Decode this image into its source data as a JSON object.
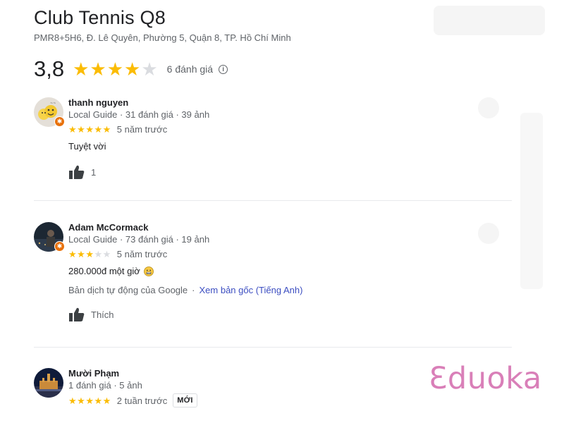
{
  "place": {
    "title": "Club Tennis Q8",
    "address": "PMR8+5H6, Đ. Lê Quyên, Phường 5, Quận 8, TP. Hồ Chí Minh",
    "rating": "3,8",
    "rating_value": 3.8,
    "review_count": "6 đánh giá",
    "info_icon": "info-icon"
  },
  "reviews": [
    {
      "name": "thanh nguyen",
      "meta": "Local Guide · 31 đánh giá · 39 ảnh",
      "stars": 5,
      "time": "5 năm trước",
      "text": "Tuyệt vời",
      "like_label": "1",
      "local_guide": true
    },
    {
      "name": "Adam McCormack",
      "meta": "Local Guide · 73 đánh giá · 19 ảnh",
      "stars": 3,
      "time": "5 năm trước",
      "text": "280.000đ một giờ",
      "emoji_icon": "grimace-emoji-icon",
      "translate_label": "Bản dịch tự động của Google",
      "translate_dot": "·",
      "translate_link": "Xem bản gốc (Tiếng Anh)",
      "like_label": "Thích",
      "local_guide": true
    },
    {
      "name": "Mười Phạm",
      "meta": "1 đánh giá · 5 ảnh",
      "stars": 5,
      "time": "2 tuần trước",
      "new_badge": "MỚI",
      "local_guide": false
    }
  ],
  "colors": {
    "star": "#fbbc04",
    "star_empty": "#dadce0",
    "link": "#3c4ec1",
    "badge": "#e8710a",
    "watermark": "#d97fb8"
  },
  "watermark": {
    "text": "Ɛduoka"
  }
}
